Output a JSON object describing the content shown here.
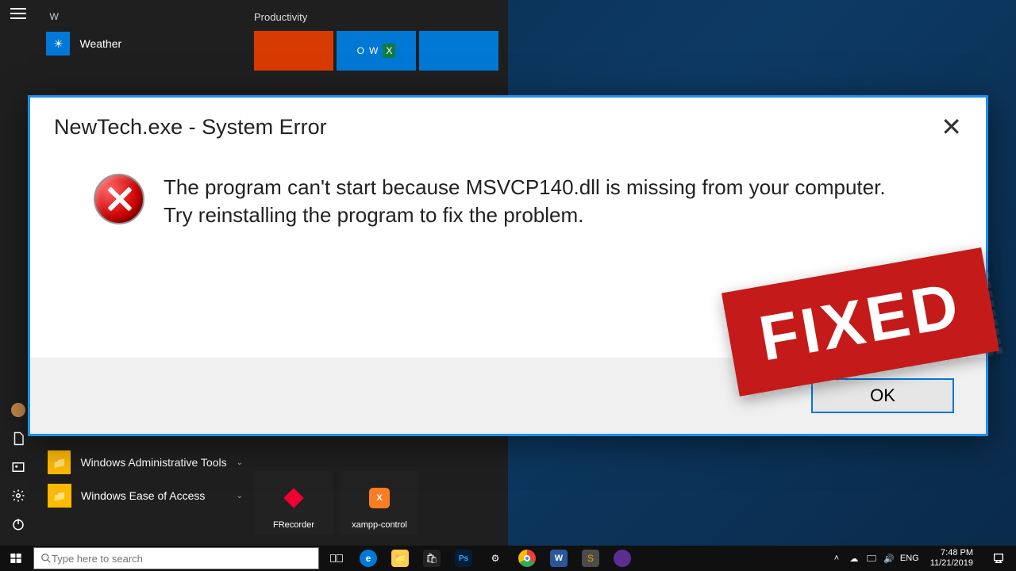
{
  "startmenu": {
    "letter": "W",
    "apps": {
      "weather": "Weather",
      "admin_tools": "Windows Administrative Tools",
      "ease": "Windows Ease of Access"
    },
    "productivity_hdr": "Productivity",
    "bottom_tiles": {
      "frecorder": "FRecorder",
      "xampp": "xampp-control"
    }
  },
  "dialog": {
    "title": "NewTech.exe - System Error",
    "message": "The program can't start because MSVCP140.dll is missing from your computer. Try reinstalling the program to fix the problem.",
    "ok": "OK"
  },
  "stamp": "FIXED",
  "taskbar": {
    "search_placeholder": "Type here to search",
    "lang": "ENG",
    "time": "7:48 PM",
    "date": "11/21/2019"
  }
}
